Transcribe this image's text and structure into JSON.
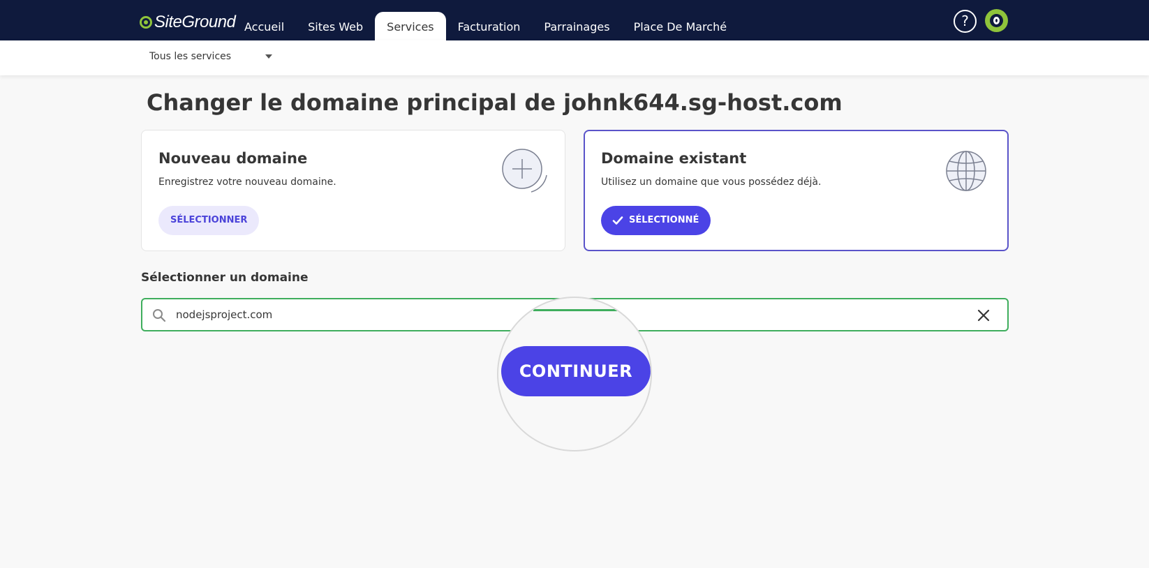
{
  "brand": {
    "logo_text": "SiteGround",
    "accent": "#8fc43b",
    "nav_bg": "#0f1a3d",
    "primary": "#4b43e6"
  },
  "nav": {
    "tabs": [
      {
        "label": "Accueil"
      },
      {
        "label": "Sites Web"
      },
      {
        "label": "Services",
        "active": true
      },
      {
        "label": "Facturation"
      },
      {
        "label": "Parrainages"
      },
      {
        "label": "Place De Marché"
      }
    ],
    "help_icon": "?"
  },
  "subnav": {
    "service_filter": "Tous les services"
  },
  "page": {
    "title": "Changer le domaine principal de johnk644.sg-host.com",
    "cards": [
      {
        "title": "Nouveau domaine",
        "description": "Enregistrez votre nouveau domaine.",
        "button": "SÉLECTIONNER",
        "icon": "plus-circle-icon"
      },
      {
        "title": "Domaine existant",
        "description": "Utilisez un domaine que vous possédez déjà.",
        "button": "SÉLECTIONNÉ",
        "icon": "globe-icon",
        "selected": true
      }
    ],
    "section_label": "Sélectionner un domaine",
    "search": {
      "value": "nodejsproject.com"
    },
    "continue_label": "CONTINUER"
  }
}
